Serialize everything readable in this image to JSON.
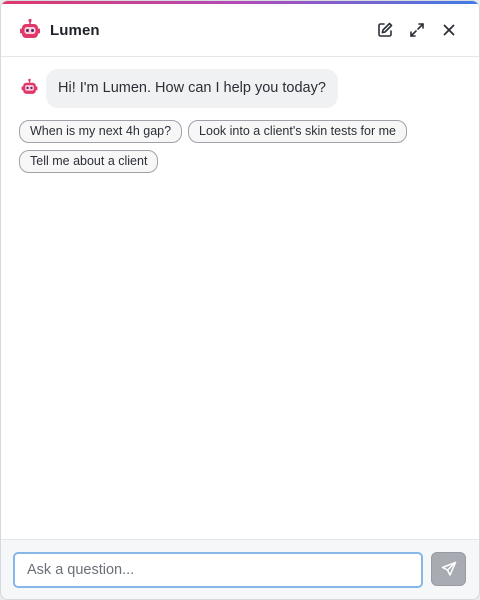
{
  "header": {
    "title": "Lumen",
    "brand_icon": "robot-icon",
    "brand_color": "#e0386a",
    "actions": [
      {
        "name": "compose-icon"
      },
      {
        "name": "expand-icon"
      },
      {
        "name": "close-icon"
      }
    ]
  },
  "conversation": {
    "assistant_greeting": "Hi! I'm Lumen. How can I help you today?",
    "suggestions": [
      "When is my next 4h gap?",
      "Look into a client's skin tests for me",
      "Tell me about a client"
    ]
  },
  "composer": {
    "placeholder": "Ask a question...",
    "value": "",
    "send_icon": "send-icon"
  },
  "colors": {
    "accent_gradient": [
      "#e0386a",
      "#b14ab8",
      "#3f7be6"
    ],
    "input_focus": "#86b7e8",
    "send_disabled": "#a8acb2"
  }
}
